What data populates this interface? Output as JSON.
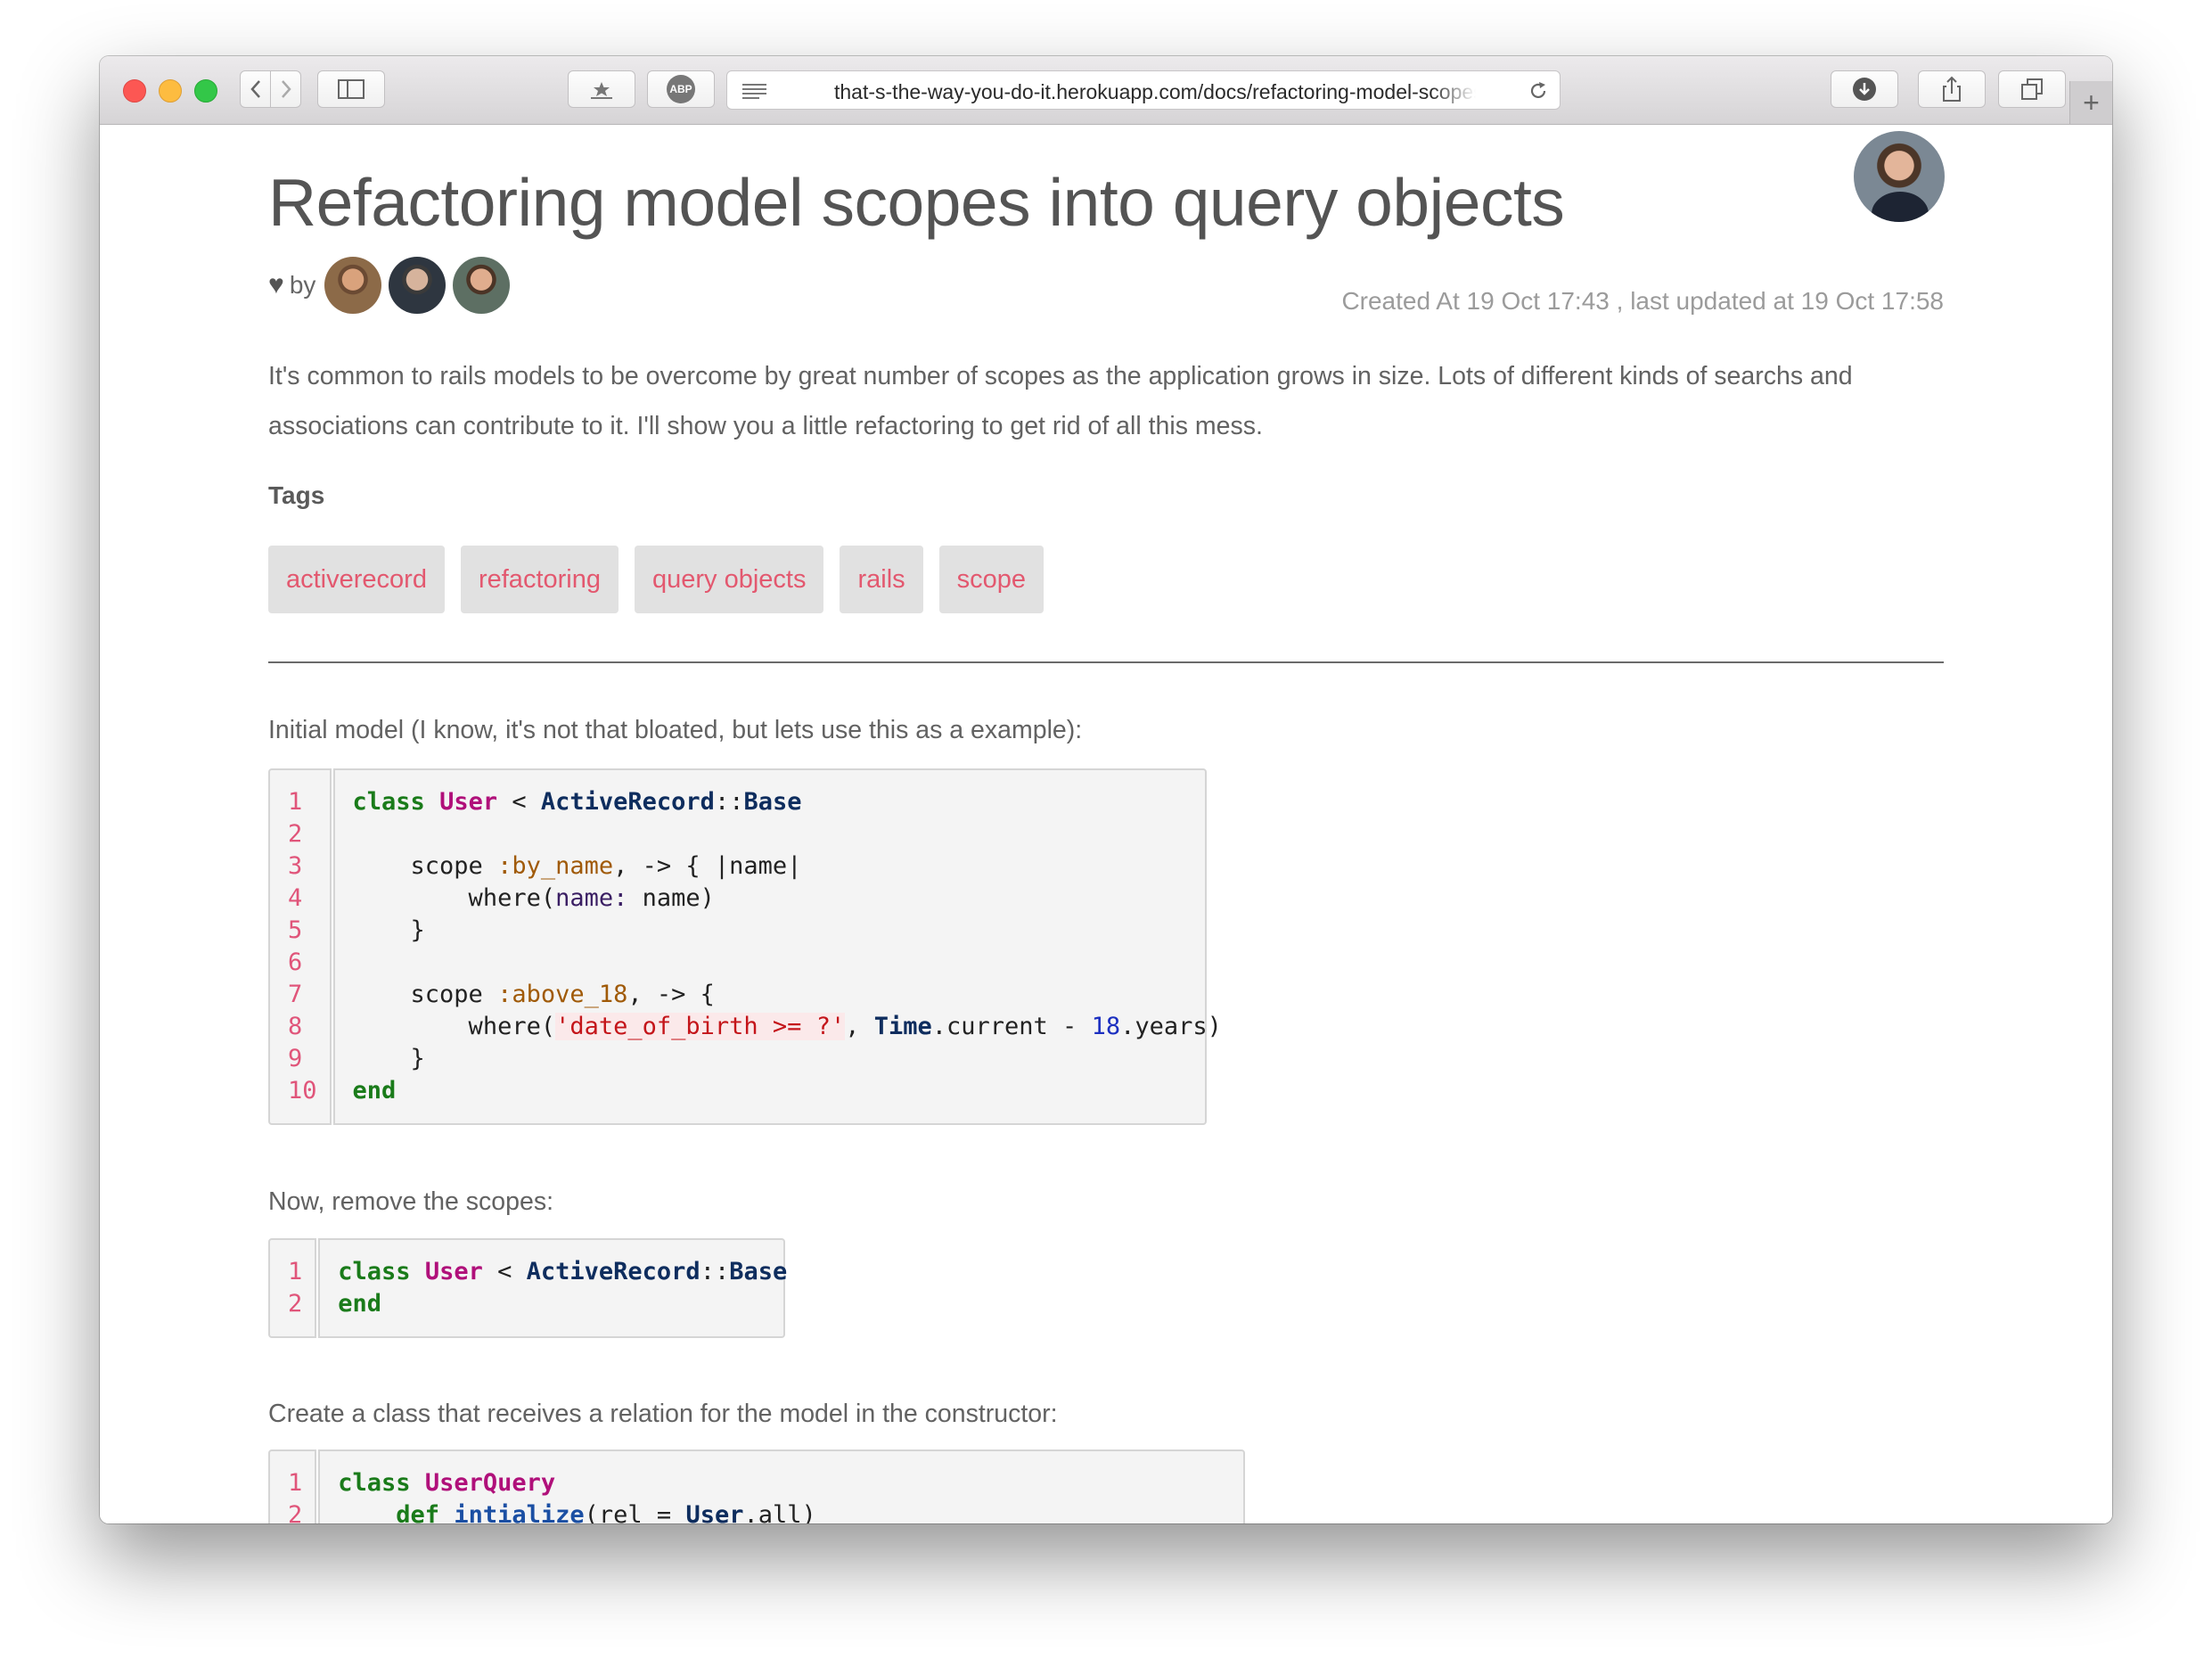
{
  "browser": {
    "url": "that-s-the-way-you-do-it.herokuapp.com/docs/refactoring-model-scopes-into-query-objects",
    "icons": [
      "back-icon",
      "forward-icon",
      "sidebar-icon",
      "bookmarks-icon",
      "adblock-icon",
      "reader-icon",
      "reload-icon",
      "download-icon",
      "share-icon",
      "tabs-icon",
      "new-tab-icon"
    ],
    "adblock_label": "ABP",
    "new_tab_label": "+"
  },
  "doc": {
    "title": "Refactoring model scopes into query objects",
    "by_label": "by",
    "contributor_count": 3,
    "meta": "Created At 19 Oct 17:43 , last updated at 19 Oct 17:58",
    "intro": "It's common to rails models to be overcome by great number of scopes as the application grows in size. Lots of different kinds of searchs and associations can contribute to it. I'll show you a little refactoring to get rid of all this mess.",
    "tags_heading": "Tags",
    "tags": [
      "activerecord",
      "refactoring",
      "query objects",
      "rails",
      "scope"
    ],
    "para1": "Initial model (I know, it's not that bloated, but lets use this as a example):",
    "para2": "Now, remove the scopes:",
    "para3": "Create a class that receives a relation for the model in the constructor:"
  },
  "code_blocks": [
    {
      "line_numbers": [
        "1",
        "2",
        "3",
        "4",
        "5",
        "6",
        "7",
        "8",
        "9",
        "10"
      ],
      "lines": [
        "class User < ActiveRecord::Base",
        "",
        "    scope :by_name, -> { |name|",
        "        where(name: name)",
        "    }",
        "",
        "    scope :above_18, -> {",
        "        where('date_of_birth >= ?', Time.current - 18.years)",
        "    }",
        "end"
      ]
    },
    {
      "line_numbers": [
        "1",
        "2"
      ],
      "lines": [
        "class User < ActiveRecord::Base",
        "end"
      ]
    },
    {
      "line_numbers": [
        "1",
        "2"
      ],
      "lines": [
        "class UserQuery",
        "    def intialize(rel = User.all)"
      ]
    }
  ],
  "colors": {
    "tag_text": "#e3586f",
    "tag_bg": "#e1e1e1",
    "line_number": "#e0557a",
    "keyword": "#1a7b1a",
    "class_name": "#b0107a",
    "constant": "#0e2d5e",
    "symbol": "#a05a08",
    "string": "#c4151a",
    "number": "#1b2fc0"
  }
}
